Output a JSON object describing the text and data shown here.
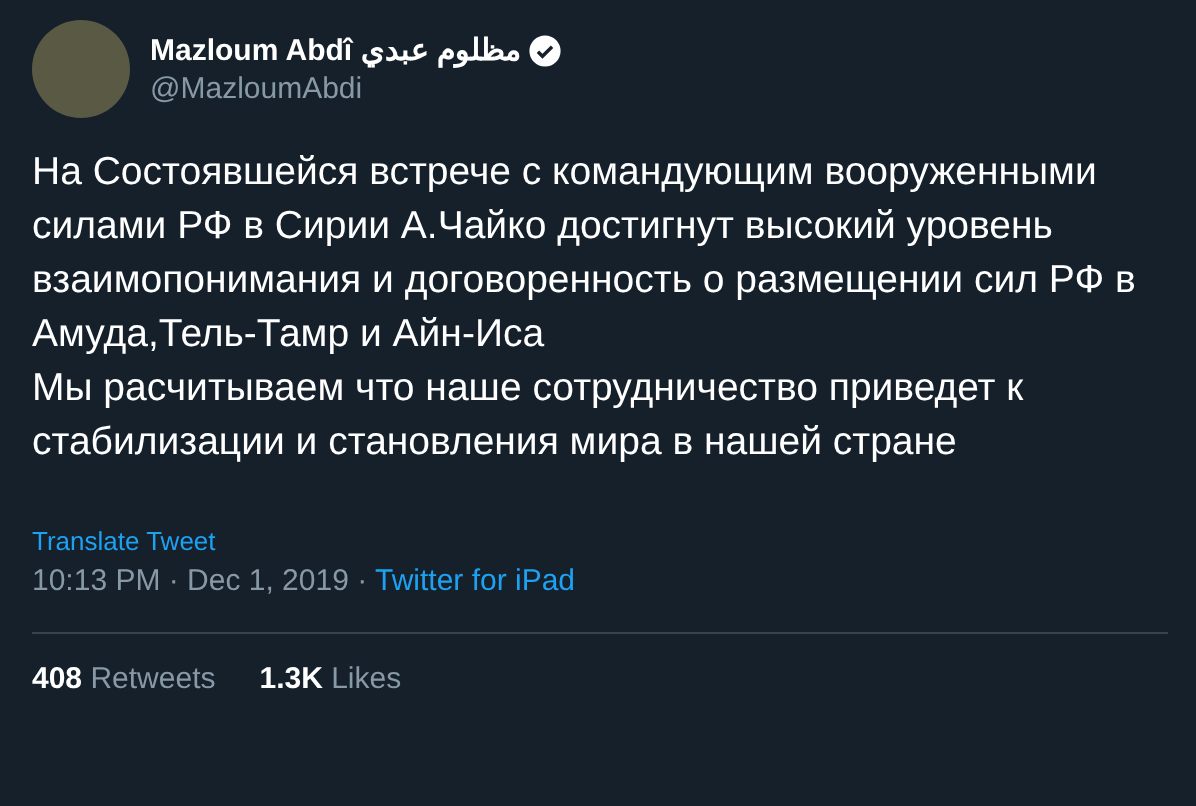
{
  "author": {
    "name": "Mazloum Abdî مظلوم عبدي",
    "verified": true,
    "handle": "@MazloumAbdi"
  },
  "tweet": {
    "paragraphs": [
      "На Состоявшейся встрече с командующим вооруженными силами РФ в Сирии А.Чайко достигнут высокий уровень взаимопонимания и договоренность о размещении сил РФ в Амуда,Тель-Тамр и Айн-Иса",
      "Мы расчитываем что наше сотрудничество приведет к стабилизации и становления мира в нашей стране"
    ],
    "translate": "Translate Tweet",
    "time": "10:13 PM · Dec 1, 2019 · ",
    "source": "Twitter for iPad"
  },
  "stats": [
    {
      "count": "408",
      "label": "Retweets"
    },
    {
      "count": "1.3K",
      "label": "Likes"
    }
  ]
}
